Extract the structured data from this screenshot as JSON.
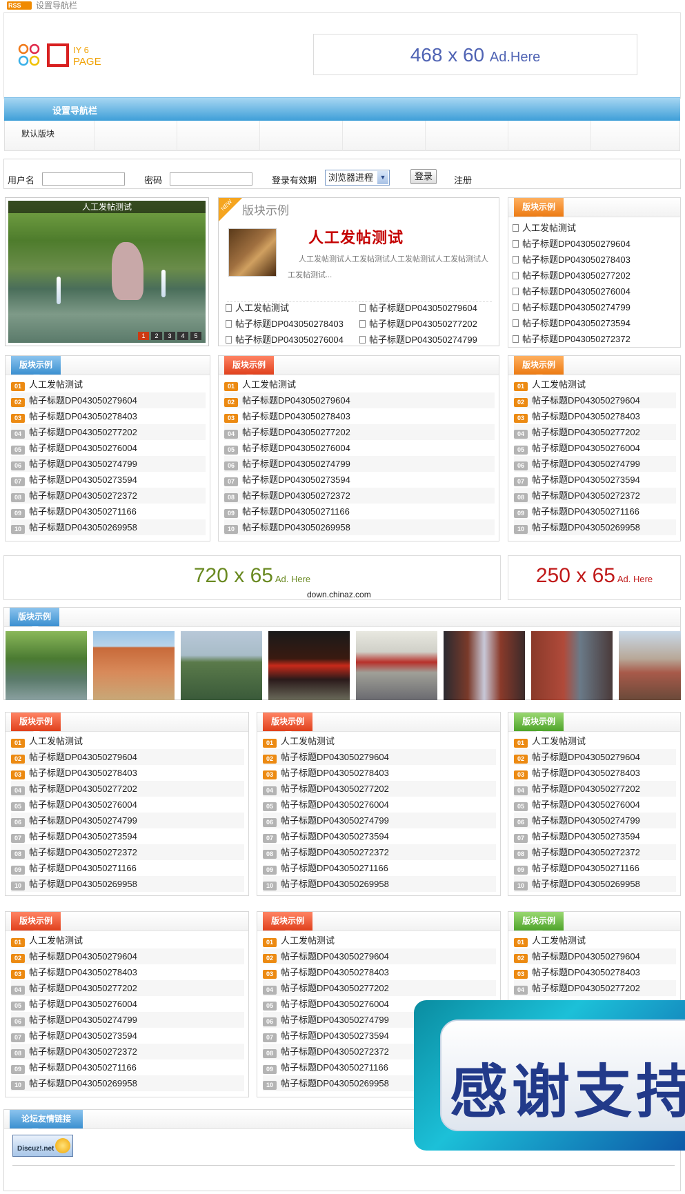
{
  "topbar": {
    "rss_label": "RSS",
    "nav_setting": "设置导航栏"
  },
  "logo": {
    "text_top": "IY 6",
    "text_bottom": "PAGE"
  },
  "ad_header": {
    "size": "468 x 60",
    "label": "Ad.Here"
  },
  "navbar": {
    "label": "设置导航栏"
  },
  "subnav": {
    "item": "默认版块"
  },
  "login": {
    "username_label": "用户名",
    "password_label": "密码",
    "expiry_label": "登录有效期",
    "expiry_value": "浏览器进程",
    "login_button": "登录",
    "register_link": "注册"
  },
  "slide": {
    "caption": "人工发帖测试",
    "pages": [
      "1",
      "2",
      "3",
      "4",
      "5"
    ]
  },
  "feature": {
    "new_tag": "NEW",
    "block_title": "版块示例",
    "headline": "人工发帖测试",
    "desc": "人工发帖测试人工发帖测试人工发帖测试人工发帖测试人工发帖测试...",
    "left_list": [
      "人工发帖测试",
      "帖子标题DP043050278403",
      "帖子标题DP043050276004"
    ],
    "right_list": [
      "帖子标题DP043050279604",
      "帖子标题DP043050277202",
      "帖子标题DP043050274799"
    ]
  },
  "right_block": {
    "title": "版块示例",
    "items": [
      "人工发帖测试",
      "帖子标题DP043050279604",
      "帖子标题DP043050278403",
      "帖子标题DP043050277202",
      "帖子标题DP043050276004",
      "帖子标题DP043050274799",
      "帖子标题DP043050273594",
      "帖子标题DP043050272372"
    ]
  },
  "block_title": "版块示例",
  "numbers": [
    "01",
    "02",
    "03",
    "04",
    "05",
    "06",
    "07",
    "08",
    "09",
    "10"
  ],
  "posts": [
    "人工发帖测试",
    "帖子标题DP043050279604",
    "帖子标题DP043050278403",
    "帖子标题DP043050277202",
    "帖子标题DP043050276004",
    "帖子标题DP043050274799",
    "帖子标题DP043050273594",
    "帖子标题DP043050272372",
    "帖子标题DP043050271166",
    "帖子标题DP043050269958"
  ],
  "ad_mid_left": {
    "size": "720 x 65",
    "label": "Ad. Here",
    "color": "#6a8a22"
  },
  "ad_mid_right": {
    "size": "250 x 65",
    "label": "Ad. Here",
    "color": "#c01a1a"
  },
  "watermark": "down.chinaz.com",
  "photo_strip": {
    "title": "版块示例"
  },
  "links": {
    "title": "论坛友情链接",
    "discuz_label": "Discuz!.net"
  },
  "thanks": {
    "text": "感谢支持"
  },
  "colors": {
    "orange": "#ec7a12",
    "blue": "#3a8fd0",
    "red": "#e0401c",
    "green": "#4ea42a"
  }
}
